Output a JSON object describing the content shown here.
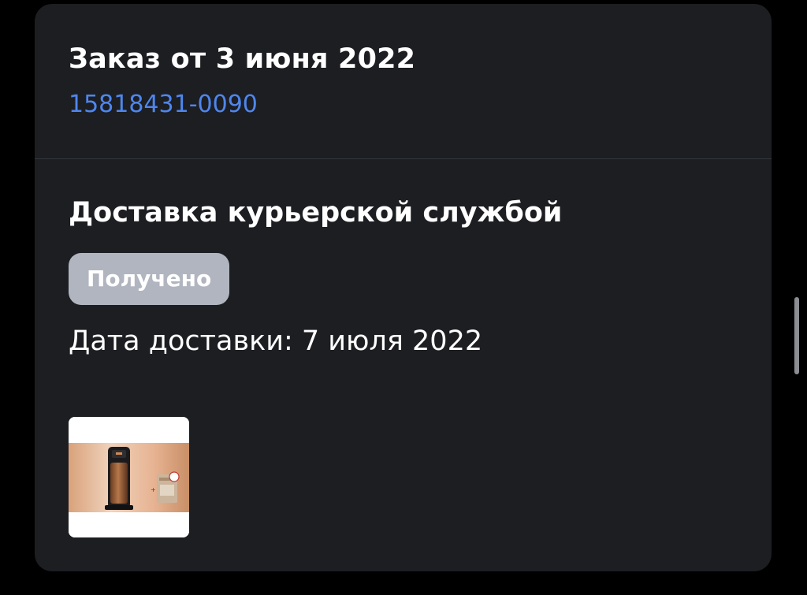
{
  "order": {
    "title": "Заказ от 3 июня 2022",
    "number": "15818431-0090"
  },
  "delivery": {
    "method": "Доставка курьерской службой",
    "status": "Получено",
    "date_text": "Дата доставки: 7 июля 2022"
  },
  "product": {
    "thumbnail_icon": "coffee-machine-product-image"
  },
  "colors": {
    "background": "#000000",
    "card": "#1c1e22",
    "link": "#4f86ee",
    "status_badge": "#b1b5bf",
    "text": "#ffffff"
  }
}
